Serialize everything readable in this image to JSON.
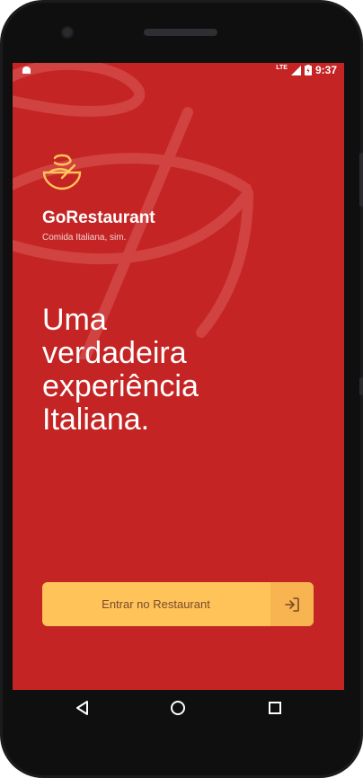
{
  "status_bar": {
    "time": "9:37",
    "network": "LTE"
  },
  "brand": {
    "name": "GoRestaurant",
    "tagline": "Comida Italiana, sim."
  },
  "headline": {
    "lines": [
      "Uma",
      "verdadeira",
      "experiência",
      "Italiana."
    ]
  },
  "cta": {
    "label": "Entrar no Restaurant",
    "icon": "log-in-icon"
  },
  "nav": {
    "back_icon": "back-triangle-icon",
    "home_icon": "home-circle-icon",
    "recents_icon": "recents-square-icon"
  },
  "colors": {
    "background": "#c42524",
    "accent": "#ffc35a",
    "accent_dark": "#f7b450",
    "cta_text": "#7a4a2a"
  }
}
